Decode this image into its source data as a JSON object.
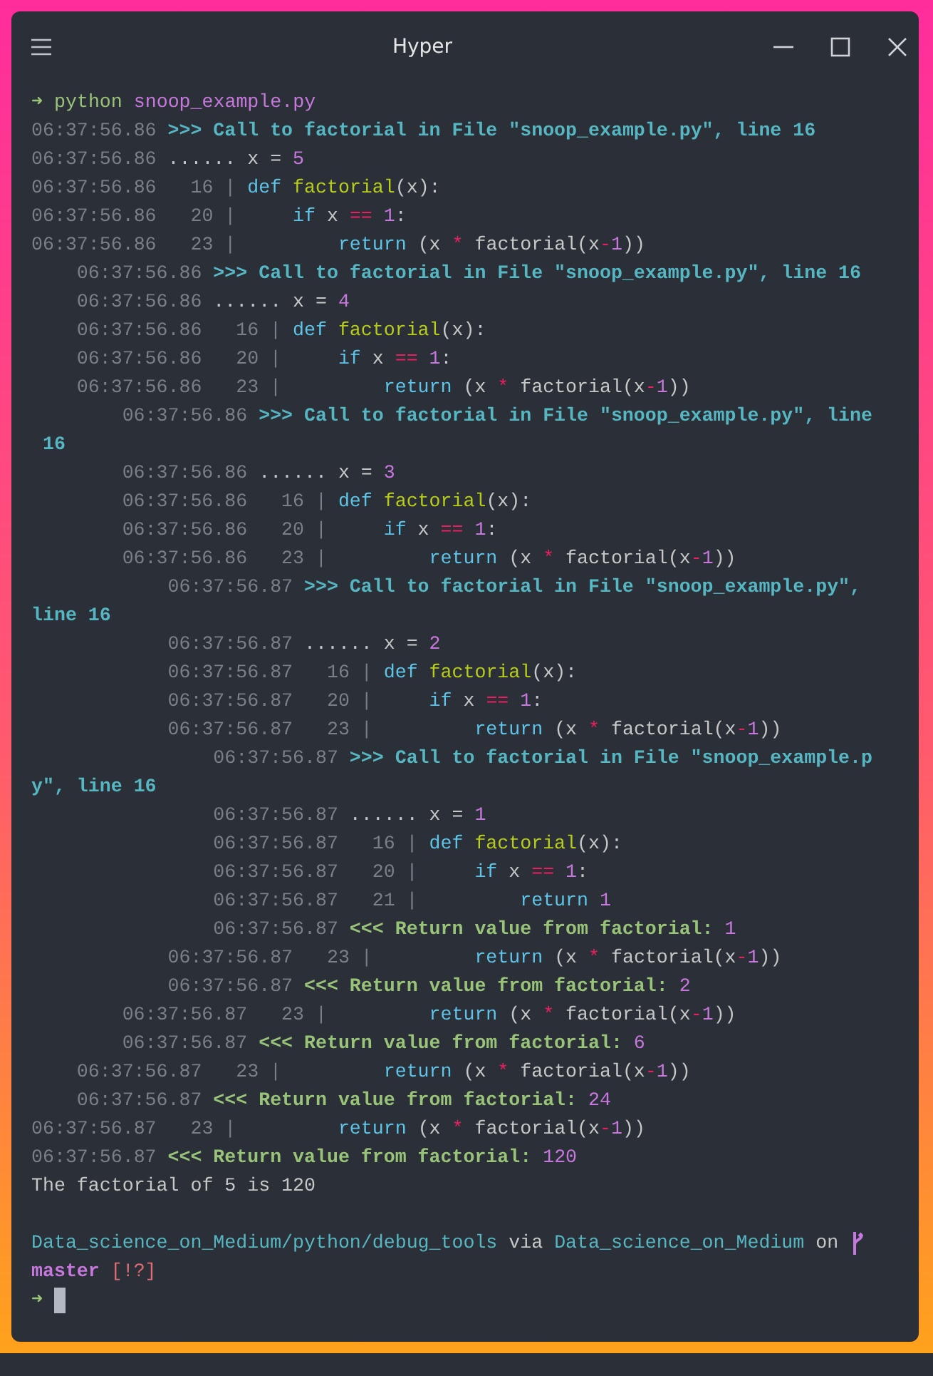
{
  "window": {
    "title": "Hyper"
  },
  "terminal": {
    "command": {
      "arrow": "➜",
      "program": "python",
      "script": "snoop_example.py"
    },
    "lines": [
      [
        {
          "kind": "time",
          "text": "06:37:56.86"
        },
        {
          "kind": "call",
          "text": " >>> Call to factorial in File \"snoop_example.py\", line 16"
        }
      ],
      [
        {
          "kind": "time",
          "text": "06:37:56.86"
        },
        {
          "kind": "text",
          "text": " ...... x = "
        },
        {
          "kind": "num",
          "text": "5"
        }
      ],
      [
        {
          "kind": "time",
          "text": "06:37:56.86   16 |"
        },
        {
          "kind": "kw",
          "text": " def"
        },
        {
          "kind": "fn",
          "text": " factorial"
        },
        {
          "kind": "text",
          "text": "(x):"
        }
      ],
      [
        {
          "kind": "time",
          "text": "06:37:56.86   20 |"
        },
        {
          "kind": "kw",
          "text": "     if"
        },
        {
          "kind": "text",
          "text": " x "
        },
        {
          "kind": "op",
          "text": "=="
        },
        {
          "kind": "num",
          "text": " 1"
        },
        {
          "kind": "text",
          "text": ":"
        }
      ],
      [
        {
          "kind": "time",
          "text": "06:37:56.86   23 |"
        },
        {
          "kind": "kw",
          "text": "         return"
        },
        {
          "kind": "text",
          "text": " (x "
        },
        {
          "kind": "op",
          "text": "*"
        },
        {
          "kind": "text",
          "text": " factorial(x"
        },
        {
          "kind": "op",
          "text": "-"
        },
        {
          "kind": "num",
          "text": "1"
        },
        {
          "kind": "text",
          "text": "))"
        }
      ],
      [
        {
          "kind": "time",
          "text": "    06:37:56.86"
        },
        {
          "kind": "call",
          "text": " >>> Call to factorial in File \"snoop_example.py\", line 16"
        }
      ],
      [
        {
          "kind": "time",
          "text": "    06:37:56.86"
        },
        {
          "kind": "text",
          "text": " ...... x = "
        },
        {
          "kind": "num",
          "text": "4"
        }
      ],
      [
        {
          "kind": "time",
          "text": "    06:37:56.86   16 |"
        },
        {
          "kind": "kw",
          "text": " def"
        },
        {
          "kind": "fn",
          "text": " factorial"
        },
        {
          "kind": "text",
          "text": "(x):"
        }
      ],
      [
        {
          "kind": "time",
          "text": "    06:37:56.86   20 |"
        },
        {
          "kind": "kw",
          "text": "     if"
        },
        {
          "kind": "text",
          "text": " x "
        },
        {
          "kind": "op",
          "text": "=="
        },
        {
          "kind": "num",
          "text": " 1"
        },
        {
          "kind": "text",
          "text": ":"
        }
      ],
      [
        {
          "kind": "time",
          "text": "    06:37:56.86   23 |"
        },
        {
          "kind": "kw",
          "text": "         return"
        },
        {
          "kind": "text",
          "text": " (x "
        },
        {
          "kind": "op",
          "text": "*"
        },
        {
          "kind": "text",
          "text": " factorial(x"
        },
        {
          "kind": "op",
          "text": "-"
        },
        {
          "kind": "num",
          "text": "1"
        },
        {
          "kind": "text",
          "text": "))"
        }
      ],
      [
        {
          "kind": "time",
          "text": "        06:37:56.86"
        },
        {
          "kind": "call",
          "text": " >>> Call to factorial in File \"snoop_example.py\", line"
        }
      ],
      [
        {
          "kind": "call",
          "text": " 16"
        }
      ],
      [
        {
          "kind": "time",
          "text": "        06:37:56.86"
        },
        {
          "kind": "text",
          "text": " ...... x = "
        },
        {
          "kind": "num",
          "text": "3"
        }
      ],
      [
        {
          "kind": "time",
          "text": "        06:37:56.86   16 |"
        },
        {
          "kind": "kw",
          "text": " def"
        },
        {
          "kind": "fn",
          "text": " factorial"
        },
        {
          "kind": "text",
          "text": "(x):"
        }
      ],
      [
        {
          "kind": "time",
          "text": "        06:37:56.86   20 |"
        },
        {
          "kind": "kw",
          "text": "     if"
        },
        {
          "kind": "text",
          "text": " x "
        },
        {
          "kind": "op",
          "text": "=="
        },
        {
          "kind": "num",
          "text": " 1"
        },
        {
          "kind": "text",
          "text": ":"
        }
      ],
      [
        {
          "kind": "time",
          "text": "        06:37:56.86   23 |"
        },
        {
          "kind": "kw",
          "text": "         return"
        },
        {
          "kind": "text",
          "text": " (x "
        },
        {
          "kind": "op",
          "text": "*"
        },
        {
          "kind": "text",
          "text": " factorial(x"
        },
        {
          "kind": "op",
          "text": "-"
        },
        {
          "kind": "num",
          "text": "1"
        },
        {
          "kind": "text",
          "text": "))"
        }
      ],
      [
        {
          "kind": "time",
          "text": "            06:37:56.87"
        },
        {
          "kind": "call",
          "text": " >>> Call to factorial in File \"snoop_example.py\","
        }
      ],
      [
        {
          "kind": "call",
          "text": "line 16"
        }
      ],
      [
        {
          "kind": "time",
          "text": "            06:37:56.87"
        },
        {
          "kind": "text",
          "text": " ...... x = "
        },
        {
          "kind": "num",
          "text": "2"
        }
      ],
      [
        {
          "kind": "time",
          "text": "            06:37:56.87   16 |"
        },
        {
          "kind": "kw",
          "text": " def"
        },
        {
          "kind": "fn",
          "text": " factorial"
        },
        {
          "kind": "text",
          "text": "(x):"
        }
      ],
      [
        {
          "kind": "time",
          "text": "            06:37:56.87   20 |"
        },
        {
          "kind": "kw",
          "text": "     if"
        },
        {
          "kind": "text",
          "text": " x "
        },
        {
          "kind": "op",
          "text": "=="
        },
        {
          "kind": "num",
          "text": " 1"
        },
        {
          "kind": "text",
          "text": ":"
        }
      ],
      [
        {
          "kind": "time",
          "text": "            06:37:56.87   23 |"
        },
        {
          "kind": "kw",
          "text": "         return"
        },
        {
          "kind": "text",
          "text": " (x "
        },
        {
          "kind": "op",
          "text": "*"
        },
        {
          "kind": "text",
          "text": " factorial(x"
        },
        {
          "kind": "op",
          "text": "-"
        },
        {
          "kind": "num",
          "text": "1"
        },
        {
          "kind": "text",
          "text": "))"
        }
      ],
      [
        {
          "kind": "time",
          "text": "                06:37:56.87"
        },
        {
          "kind": "call",
          "text": " >>> Call to factorial in File \"snoop_example.p"
        }
      ],
      [
        {
          "kind": "call",
          "text": "y\", line 16"
        }
      ],
      [
        {
          "kind": "time",
          "text": "                06:37:56.87"
        },
        {
          "kind": "text",
          "text": " ...... x = "
        },
        {
          "kind": "num",
          "text": "1"
        }
      ],
      [
        {
          "kind": "time",
          "text": "                06:37:56.87   16 |"
        },
        {
          "kind": "kw",
          "text": " def"
        },
        {
          "kind": "fn",
          "text": " factorial"
        },
        {
          "kind": "text",
          "text": "(x):"
        }
      ],
      [
        {
          "kind": "time",
          "text": "                06:37:56.87   20 |"
        },
        {
          "kind": "kw",
          "text": "     if"
        },
        {
          "kind": "text",
          "text": " x "
        },
        {
          "kind": "op",
          "text": "=="
        },
        {
          "kind": "num",
          "text": " 1"
        },
        {
          "kind": "text",
          "text": ":"
        }
      ],
      [
        {
          "kind": "time",
          "text": "                06:37:56.87   21 |"
        },
        {
          "kind": "kw",
          "text": "         return"
        },
        {
          "kind": "num",
          "text": " 1"
        }
      ],
      [
        {
          "kind": "time",
          "text": "                06:37:56.87"
        },
        {
          "kind": "ret",
          "text": " <<< Return value from factorial:"
        },
        {
          "kind": "num",
          "text": " 1"
        }
      ],
      [
        {
          "kind": "time",
          "text": "            06:37:56.87   23 |"
        },
        {
          "kind": "kw",
          "text": "         return"
        },
        {
          "kind": "text",
          "text": " (x "
        },
        {
          "kind": "op",
          "text": "*"
        },
        {
          "kind": "text",
          "text": " factorial(x"
        },
        {
          "kind": "op",
          "text": "-"
        },
        {
          "kind": "num",
          "text": "1"
        },
        {
          "kind": "text",
          "text": "))"
        }
      ],
      [
        {
          "kind": "time",
          "text": "            06:37:56.87"
        },
        {
          "kind": "ret",
          "text": " <<< Return value from factorial:"
        },
        {
          "kind": "num",
          "text": " 2"
        }
      ],
      [
        {
          "kind": "time",
          "text": "        06:37:56.87   23 |"
        },
        {
          "kind": "kw",
          "text": "         return"
        },
        {
          "kind": "text",
          "text": " (x "
        },
        {
          "kind": "op",
          "text": "*"
        },
        {
          "kind": "text",
          "text": " factorial(x"
        },
        {
          "kind": "op",
          "text": "-"
        },
        {
          "kind": "num",
          "text": "1"
        },
        {
          "kind": "text",
          "text": "))"
        }
      ],
      [
        {
          "kind": "time",
          "text": "        06:37:56.87"
        },
        {
          "kind": "ret",
          "text": " <<< Return value from factorial:"
        },
        {
          "kind": "num",
          "text": " 6"
        }
      ],
      [
        {
          "kind": "time",
          "text": "    06:37:56.87   23 |"
        },
        {
          "kind": "kw",
          "text": "         return"
        },
        {
          "kind": "text",
          "text": " (x "
        },
        {
          "kind": "op",
          "text": "*"
        },
        {
          "kind": "text",
          "text": " factorial(x"
        },
        {
          "kind": "op",
          "text": "-"
        },
        {
          "kind": "num",
          "text": "1"
        },
        {
          "kind": "text",
          "text": "))"
        }
      ],
      [
        {
          "kind": "time",
          "text": "    06:37:56.87"
        },
        {
          "kind": "ret",
          "text": " <<< Return value from factorial:"
        },
        {
          "kind": "num",
          "text": " 24"
        }
      ],
      [
        {
          "kind": "time",
          "text": "06:37:56.87   23 |"
        },
        {
          "kind": "kw",
          "text": "         return"
        },
        {
          "kind": "text",
          "text": " (x "
        },
        {
          "kind": "op",
          "text": "*"
        },
        {
          "kind": "text",
          "text": " factorial(x"
        },
        {
          "kind": "op",
          "text": "-"
        },
        {
          "kind": "num",
          "text": "1"
        },
        {
          "kind": "text",
          "text": "))"
        }
      ],
      [
        {
          "kind": "time",
          "text": "06:37:56.87"
        },
        {
          "kind": "ret",
          "text": " <<< Return value from factorial:"
        },
        {
          "kind": "num",
          "text": " 120"
        }
      ],
      [
        {
          "kind": "text",
          "text": "The factorial of 5 is 120"
        }
      ]
    ],
    "status": {
      "path": "Data_science_on_Medium/python/debug_tools",
      "via": "via",
      "env": "Data_science_on_Medium",
      "on": "on",
      "branch": "master",
      "flags": "[!?]"
    },
    "prompt": {
      "arrow": "➜"
    }
  }
}
